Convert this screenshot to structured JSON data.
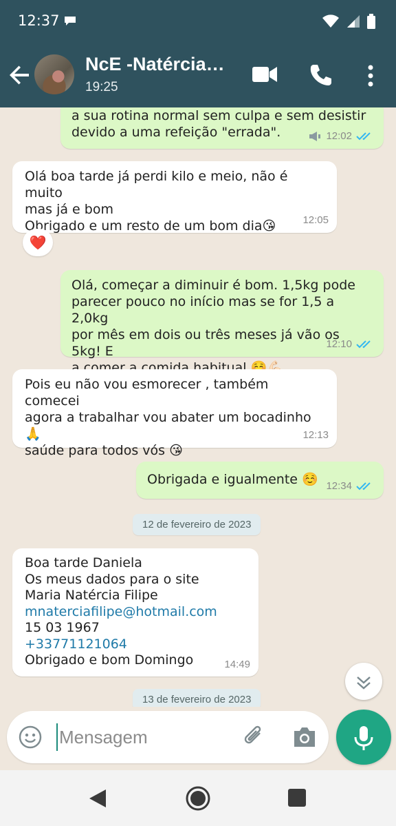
{
  "status_bar": {
    "time": "12:37"
  },
  "header": {
    "contact_name": "NcE -Natércia…",
    "subtitle": "19:25"
  },
  "messages": [
    {
      "direction": "out",
      "text": "a sua rotina normal sem culpa e sem desistir\ndevido a uma refeição \"errada\".",
      "time": "12:02",
      "ticks": "read",
      "speaker": true
    },
    {
      "direction": "in",
      "text": "Olá boa tarde já perdi kilo e meio, não é muito\nmas já e bom\nObrigado e um resto de um bom dia😘",
      "time": "12:05",
      "reaction": "❤️"
    },
    {
      "direction": "out",
      "text": "Olá, começar a diminuir é bom. 1,5kg pode\nparecer pouco no início mas se for 1,5 a 2,0kg\npor mês em dois ou três meses já vão os 5kg! E\na comer a comida habitual ☺️💪🏻",
      "time": "12:10",
      "ticks": "read"
    },
    {
      "direction": "in",
      "text": "Pois eu não vou esmorecer , também comecei\nagora a trabalhar vou abater um bocadinho🙏\nsaúde para todos vós 😘",
      "time": "12:13"
    },
    {
      "direction": "out",
      "text": "Obrigada e igualmente ☺️",
      "time": "12:34",
      "ticks": "read"
    },
    {
      "direction": "in",
      "lines": [
        "Boa tarde Daniela",
        "Os meus dados para o site",
        "Maria Natércia Filipe"
      ],
      "email": "mnaterciafilipe@hotmail.com",
      "birth": "15 03 1967",
      "phone": "+33771121064",
      "closing": "Obrigado e bom Domingo",
      "time": "14:49"
    }
  ],
  "date_separators": [
    "12 de fevereiro de 2023",
    "13 de fevereiro de 2023"
  ],
  "composer": {
    "placeholder": "Mensagem"
  },
  "colors": {
    "header": "#2f525e",
    "outgoing": "#dcf8c6",
    "incoming": "#ffffff",
    "accent": "#1fa684",
    "read_ticks": "#34b7f1"
  },
  "icons": [
    "back-arrow-icon",
    "video-call-icon",
    "phone-icon",
    "more-vert-icon",
    "emoji-icon",
    "attach-icon",
    "camera-icon",
    "mic-icon",
    "double-chevron-down-icon",
    "heart-icon"
  ]
}
